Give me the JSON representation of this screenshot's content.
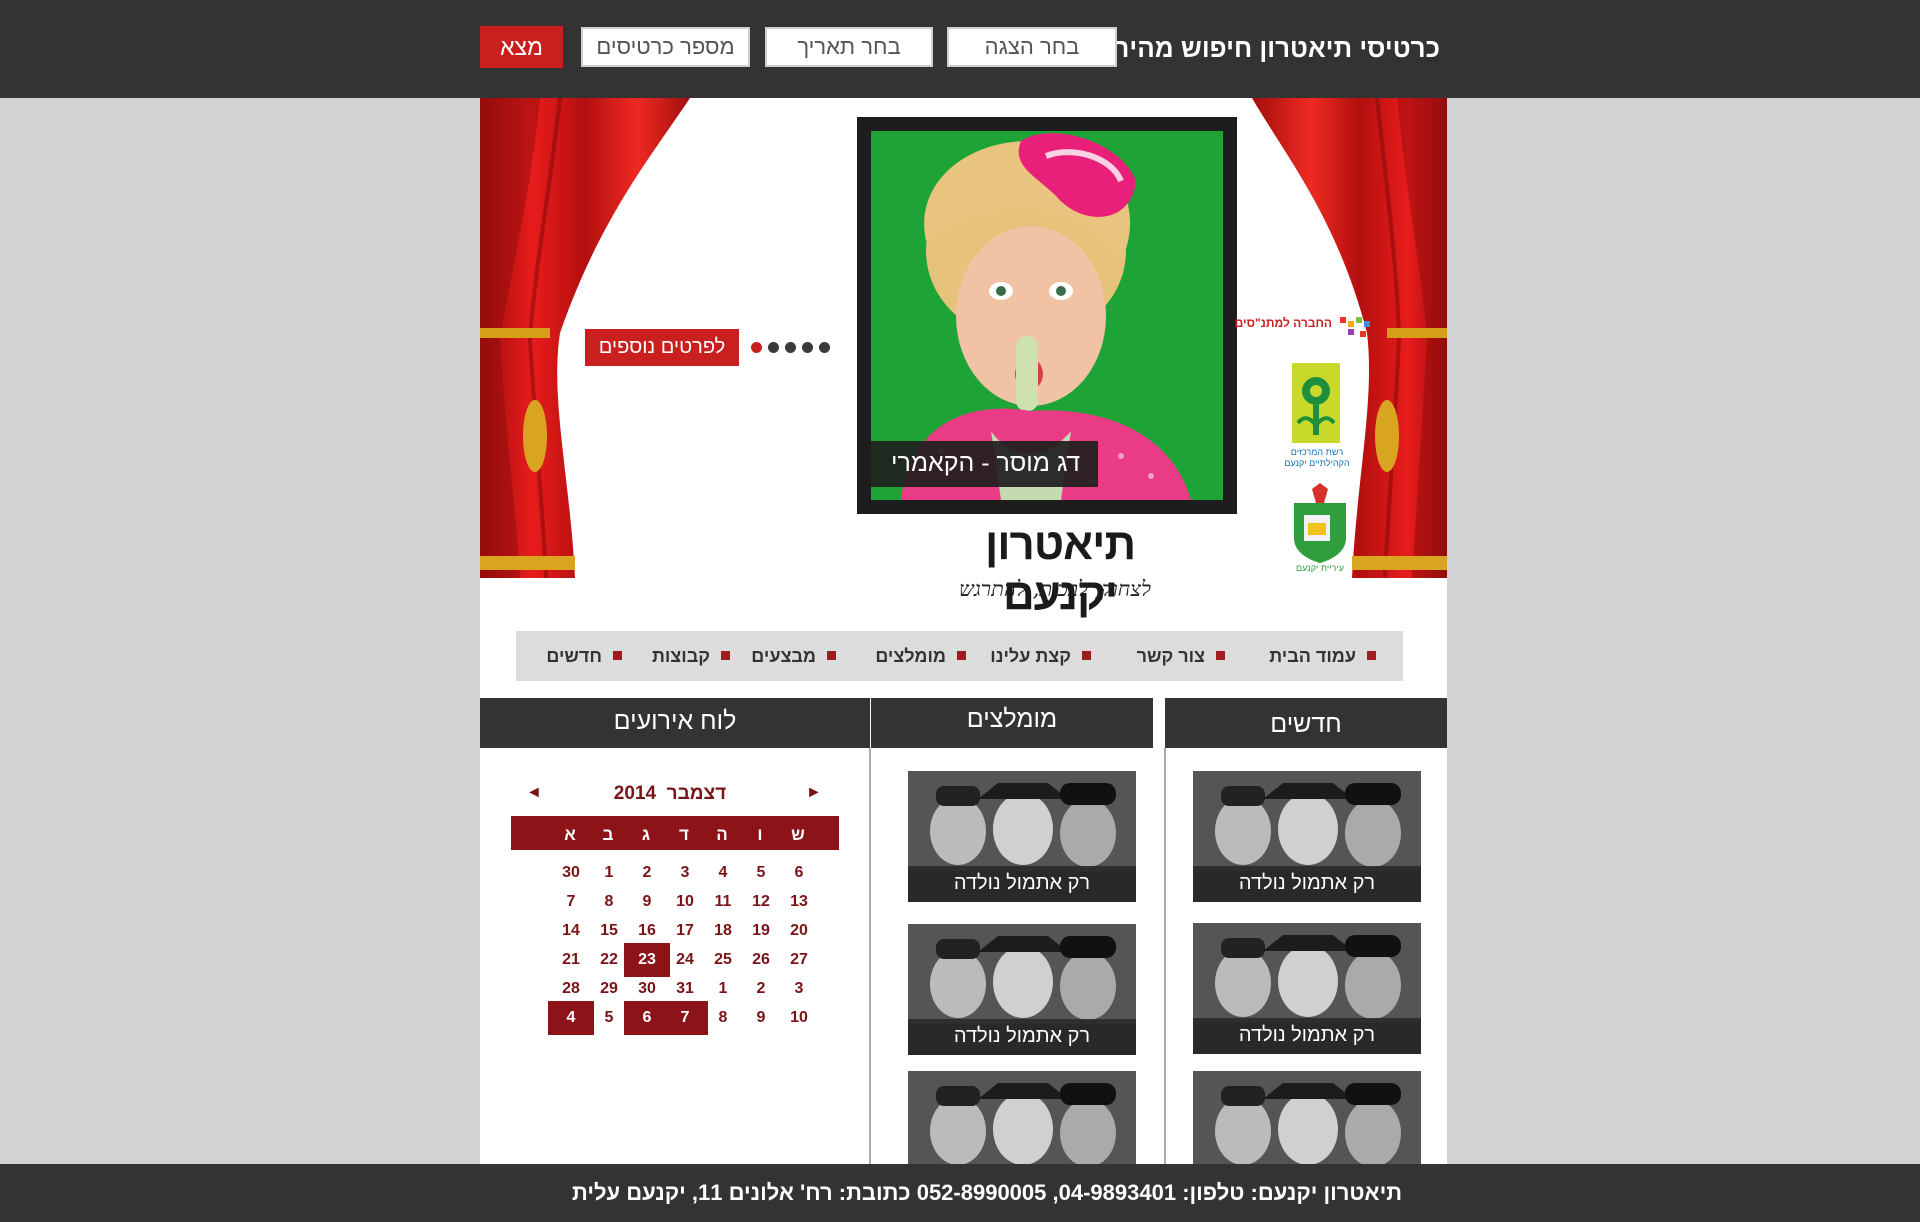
{
  "search": {
    "title": "כרטיסי תיאטרון חיפוש מהיר:",
    "show_placeholder": "בחר הצגה",
    "date_placeholder": "בחר תאריך",
    "tickets_placeholder": "מספר כרטיסים",
    "submit_label": "מצא"
  },
  "hero": {
    "caption": "דג מוסר - הקאמרי",
    "more_label": "לפרטים נוספים",
    "slides": 5,
    "active_slide": 5
  },
  "logo": {
    "title": "תיאטרון יקנעם",
    "tagline": "לצחוק, לבכות, להתרגש"
  },
  "sponsors": {
    "top": "החברה למתנ\"סים",
    "middle": "רשת המרכזים הקהילתיים יקנעם",
    "bottom": "עיריית יקנעם"
  },
  "nav": {
    "items": [
      "עמוד הבית",
      "צור קשר",
      "קצת עלינו",
      "מומלצים",
      "מבצעים",
      "קבוצות",
      "חדשים"
    ]
  },
  "columns": {
    "news_title": "חדשים",
    "recommended_title": "מומלצים",
    "calendar_title": "לוח אירועים"
  },
  "news": [
    {
      "title": "רק אתמול נולדה"
    },
    {
      "title": "רק אתמול נולדה"
    },
    {
      "title": ""
    }
  ],
  "recommended": [
    {
      "title": "רק אתמול נולדה"
    },
    {
      "title": "רק אתמול נולדה"
    },
    {
      "title": ""
    }
  ],
  "calendar": {
    "month": "דצמבר",
    "year": "2014",
    "prev_icon": "◄",
    "next_icon": "►",
    "day_names": [
      "ש",
      "ו",
      "ה",
      "ד",
      "ג",
      "ב",
      "א"
    ],
    "weeks": [
      [
        "6",
        "5",
        "4",
        "3",
        "2",
        "1",
        "30"
      ],
      [
        "13",
        "12",
        "11",
        "10",
        "9",
        "8",
        "7"
      ],
      [
        "20",
        "19",
        "18",
        "17",
        "16",
        "15",
        "14"
      ],
      [
        "27",
        "26",
        "25",
        "24",
        "23",
        "22",
        "21"
      ],
      [
        "3",
        "2",
        "1",
        "31",
        "30",
        "29",
        "28"
      ],
      [
        "10",
        "9",
        "8",
        "7",
        "6",
        "5",
        "4"
      ]
    ],
    "highlighted": [
      "23",
      "7",
      "6",
      "4"
    ]
  },
  "footer": {
    "text": "תיאטרון יקנעם: טלפון: 04-9893401, 052-8990005 כתובת: רח' אלונים 11, יקנעם עלית"
  },
  "colors": {
    "accent": "#c9201f",
    "dark_bar": "#333334",
    "calendar_red": "#8c1419",
    "page_bg": "#d1d2d4"
  }
}
